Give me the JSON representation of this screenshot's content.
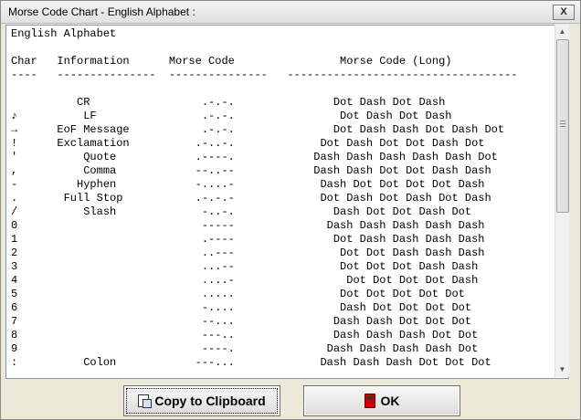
{
  "window": {
    "title": "Morse Code Chart - English Alphabet :",
    "close_label": "X"
  },
  "text_lines": [
    "English Alphabet",
    "",
    "Char   Information      Morse Code                Morse Code (Long)",
    "----   ---------------  ---------------   -----------------------------------",
    "",
    "          CR                 .-.-.               Dot Dash Dot Dash",
    "♪          LF                .-.-.                Dot Dash Dot Dash",
    "→      EoF Message           .-.-.               Dot Dash Dash Dot Dash Dot",
    "!      Exclamation          .-..-.             Dot Dash Dot Dot Dash Dot",
    "'          Quote            .----.            Dash Dash Dash Dash Dash Dot",
    ",          Comma            --..--            Dash Dash Dot Dot Dash Dash",
    "-         Hyphen            -....-             Dash Dot Dot Dot Dot Dash",
    ".       Full Stop           .-.-.-             Dot Dash Dot Dash Dot Dash",
    "/          Slash             -..-.               Dash Dot Dot Dash Dot",
    "0                            -----              Dash Dash Dash Dash Dash",
    "1                            .----               Dot Dash Dash Dash Dash",
    "2                            ..---                Dot Dot Dash Dash Dash",
    "3                            ...--                Dot Dot Dot Dash Dash",
    "4                            ....-                 Dot Dot Dot Dot Dash",
    "5                            .....                Dot Dot Dot Dot Dot",
    "6                            -....                Dash Dot Dot Dot Dot",
    "7                            --...               Dash Dash Dot Dot Dot",
    "8                            ---..               Dash Dash Dash Dot Dot",
    "9                            ----.              Dash Dash Dash Dash Dot",
    ":          Colon            ---...             Dash Dash Dash Dot Dot Dot"
  ],
  "buttons": {
    "copy_label": "Copy to Clipboard",
    "ok_label": "OK"
  }
}
